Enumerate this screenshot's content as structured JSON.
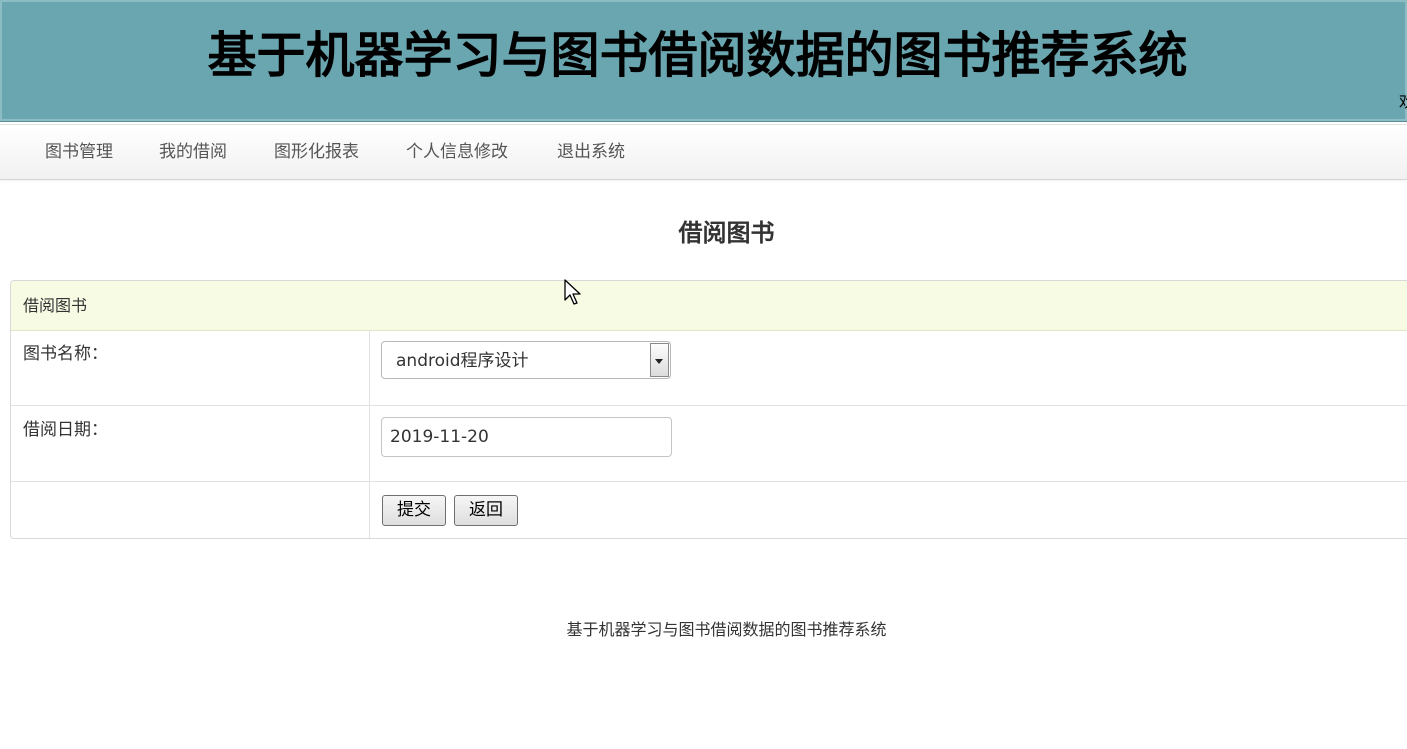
{
  "banner": {
    "title": "基于机器学习与图书借阅数据的图书推荐系统",
    "edge_fragment": "欢"
  },
  "nav": {
    "items": [
      {
        "label": "图书管理"
      },
      {
        "label": "我的借阅"
      },
      {
        "label": "图形化报表"
      },
      {
        "label": "个人信息修改"
      },
      {
        "label": "退出系统"
      }
    ]
  },
  "page": {
    "heading": "借阅图书"
  },
  "form": {
    "panel_title": "借阅图书",
    "book_name_label": "图书名称：",
    "book_name_selected": "android程序设计",
    "borrow_date_label": "借阅日期：",
    "borrow_date_value": "2019-11-20",
    "submit_label": "提交",
    "back_label": "返回"
  },
  "footer": {
    "text": "基于机器学习与图书借阅数据的图书推荐系统"
  },
  "icons": {
    "cursor": "mouse-pointer-icon",
    "select_arrow": "chevron-down-icon"
  },
  "colors": {
    "banner_bg": "#6aa6b0",
    "panel_header_bg": "#f7fbe3"
  }
}
